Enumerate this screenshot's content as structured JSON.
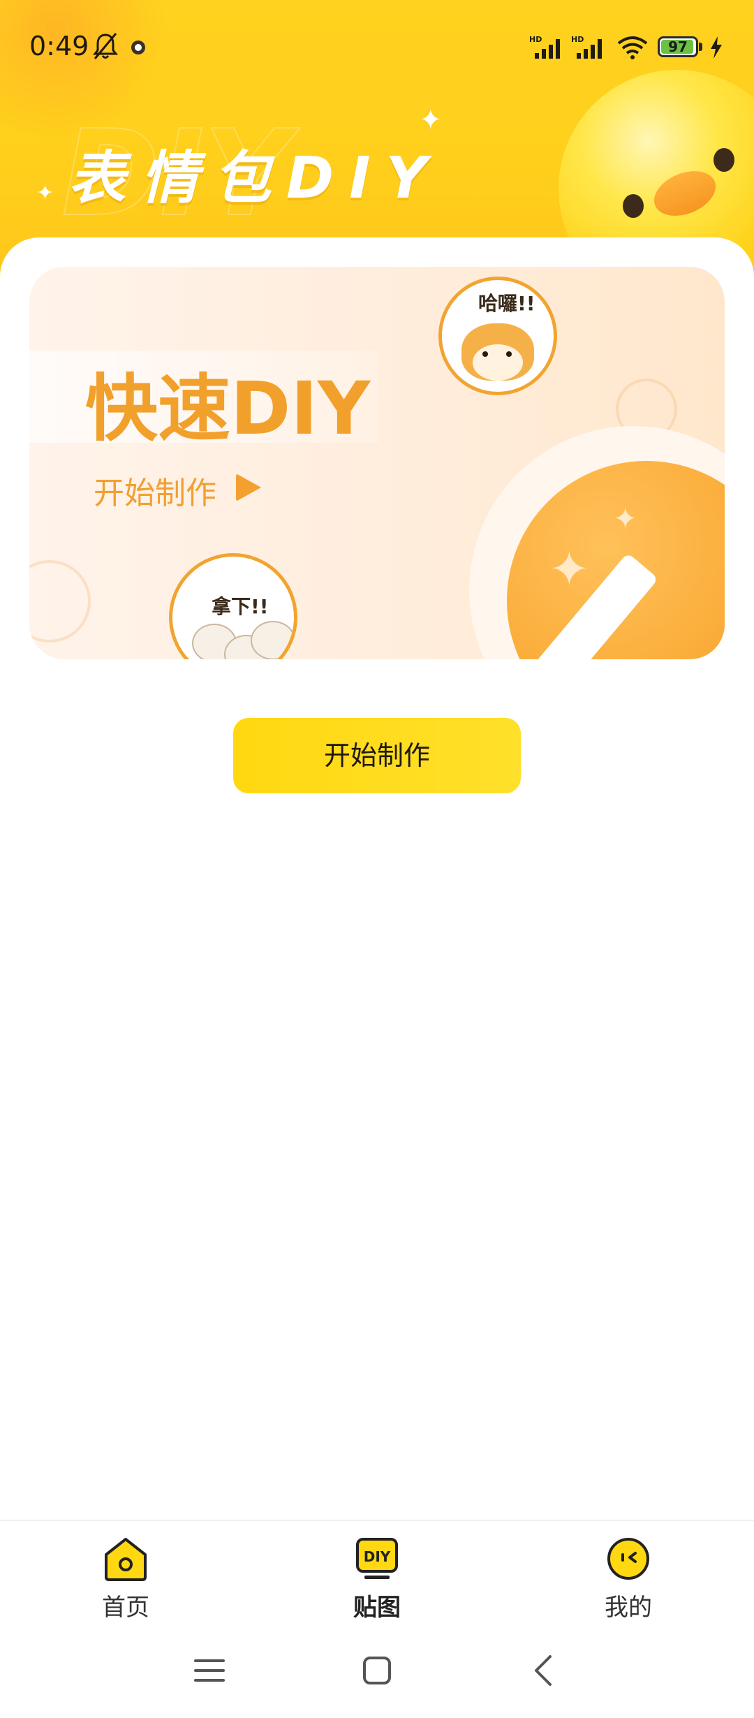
{
  "status_bar": {
    "time": "0:49",
    "battery_level": "97",
    "icons": [
      "mute-bell-icon",
      "notification-app-icon",
      "hd-signal-icon",
      "hd-signal-icon",
      "wifi-icon",
      "battery-icon",
      "charging-bolt-icon"
    ]
  },
  "header": {
    "title": "表情包DIY"
  },
  "banner": {
    "title": "快速DIY",
    "subtitle": "开始制作",
    "sticker_top_caption": "哈囉!!",
    "sticker_bottom_caption": "拿下!!"
  },
  "start_button": {
    "label": "开始制作"
  },
  "tab_bar": {
    "tabs": [
      {
        "label": "首页",
        "icon": "home-icon",
        "active": false
      },
      {
        "label": "贴图",
        "icon": "diy-icon",
        "active": true,
        "icon_text": "DIY"
      },
      {
        "label": "我的",
        "icon": "profile-face-icon",
        "active": false
      }
    ]
  },
  "nav_bar": {
    "icons": [
      "menu-icon",
      "home-square-icon",
      "back-icon"
    ]
  },
  "colors": {
    "accent_yellow": "#ffd21f",
    "banner_orange": "#f2a02c",
    "battery_green": "#6ac143"
  }
}
